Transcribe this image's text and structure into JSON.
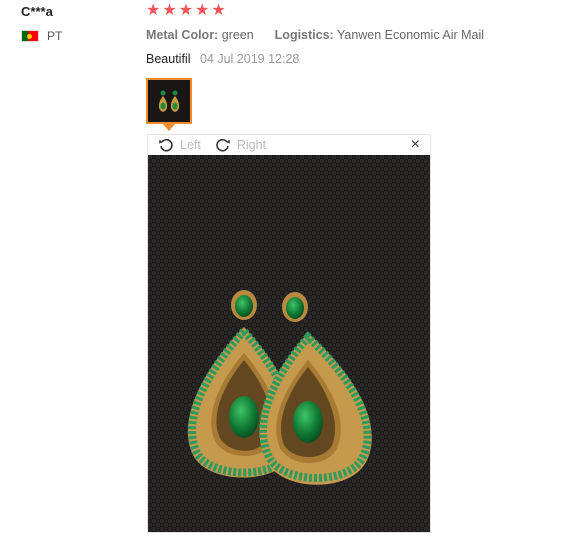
{
  "review": {
    "user": "C***a",
    "country": "PT",
    "rating": 5,
    "attributes": [
      {
        "key": "Metal Color:",
        "value": "green"
      },
      {
        "key": "Logistics:",
        "value": "Yanwen Economic Air Mail"
      }
    ],
    "feedback_text": "Beautifil",
    "date": "04 Jul 2019 12:28"
  },
  "viewer": {
    "left_label": "Left",
    "right_label": "Right",
    "close_label": "×"
  }
}
